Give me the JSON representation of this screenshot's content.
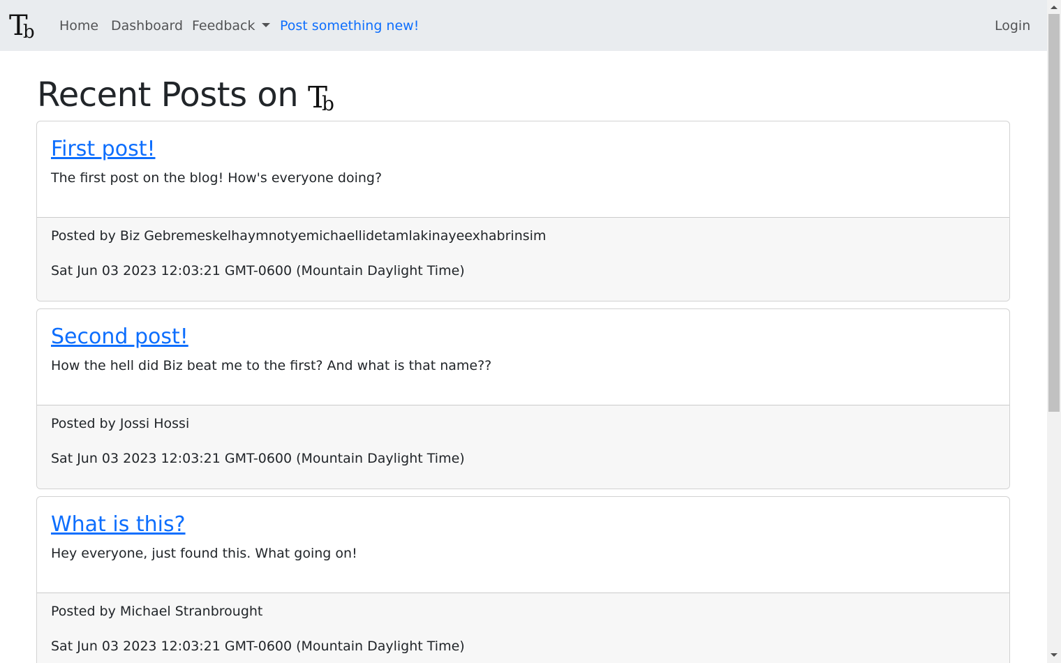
{
  "navbar": {
    "brand_icon": "tb-logo-icon",
    "links": [
      {
        "label": "Home"
      },
      {
        "label": "Dashboard"
      },
      {
        "label": "Feedback"
      },
      {
        "label": "Post something new!"
      }
    ],
    "login_label": "Login",
    "accent_color": "#0d6efd",
    "background_color": "#e9ecef"
  },
  "main": {
    "title": "Recent Posts on",
    "title_icon": "tb-logo-icon"
  },
  "posts": [
    {
      "title": "First post!",
      "body": "The first post on the blog! How's everyone doing?",
      "author_line": "Posted by Biz Gebremeskelhaymnotyemichaellidetamlakinayeexhabrinsim",
      "date": "Sat Jun 03 2023 12:03:21 GMT-0600 (Mountain Daylight Time)"
    },
    {
      "title": "Second post!",
      "body": "How the hell did Biz beat me to the first? And what is that name??",
      "author_line": "Posted by Jossi Hossi",
      "date": "Sat Jun 03 2023 12:03:21 GMT-0600 (Mountain Daylight Time)"
    },
    {
      "title": "What is this?",
      "body": "Hey everyone, just found this. What going on!",
      "author_line": "Posted by Michael Stranbrought",
      "date": "Sat Jun 03 2023 12:03:21 GMT-0600 (Mountain Daylight Time)"
    }
  ]
}
